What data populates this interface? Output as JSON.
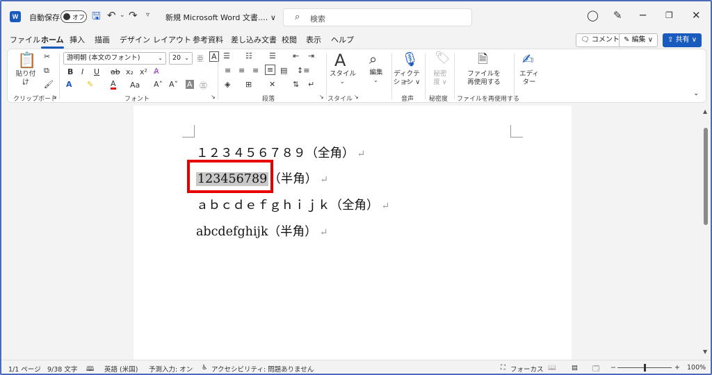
{
  "titlebar": {
    "autosave_label": "自動保存",
    "autosave_state": "オフ",
    "doc_name": "新規 Microsoft Word 文書.… ∨",
    "search_placeholder": "検索"
  },
  "tabs": [
    "ファイル",
    "ホーム",
    "挿入",
    "描画",
    "デザイン",
    "レイアウト",
    "参考資料",
    "差し込み文書",
    "校閲",
    "表示",
    "ヘルプ"
  ],
  "tab_buttons": {
    "comment": "コメント",
    "edit": "編集 ∨",
    "share": "共有 ∨"
  },
  "ribbon": {
    "paste_label": "貼り付け",
    "font_name": "游明朝 (本文のフォント)",
    "font_size": "20",
    "style_label": "スタイル",
    "edit_label": "編集",
    "dictate_label_1": "ディクテー",
    "dictate_label_2": "ション ∨",
    "sensitivity_label_1": "秘密",
    "sensitivity_label_2": "度 ∨",
    "reuse_label_1": "ファイルを",
    "reuse_label_2": "再使用する",
    "editor_label_1": "エディ",
    "editor_label_2": "ター",
    "groups": {
      "clipboard": "クリップボード",
      "font": "フォント",
      "paragraph": "段落",
      "style": "スタイル",
      "voice": "音声",
      "sensitivity": "秘密度",
      "reuse": "ファイルを再使用する"
    }
  },
  "document": {
    "line1": "１２３４５６７８９（全角）",
    "line2_hl": "123456789",
    "line2_rest": "（半角）",
    "line3": "ａｂｃｄｅｆｇｈｉｊｋ（全角）",
    "line4": "abcdefghijk（半角）"
  },
  "statusbar": {
    "page": "1/1 ページ",
    "words": "9/38 文字",
    "language": "英語 (米国)",
    "predict": "予測入力: オン",
    "accessibility": "アクセシビリティ: 問題ありません",
    "focus": "フォーカス",
    "zoom": "100%"
  },
  "colors": {
    "accent": "#185abd",
    "highlight_box": "#e60000",
    "selection": "#c8c8c8"
  }
}
